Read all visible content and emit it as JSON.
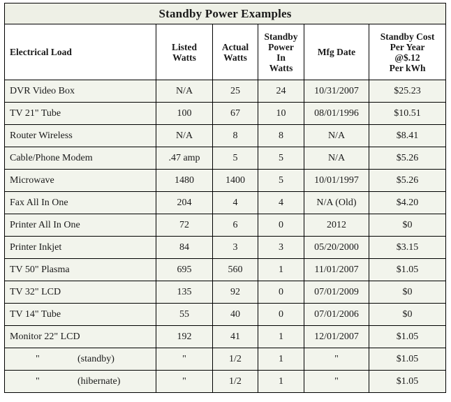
{
  "table": {
    "title": "Standby Power Examples",
    "columns": [
      {
        "key": "load",
        "label": "Electrical Load"
      },
      {
        "key": "listed",
        "label": "Listed\nWatts",
        "label_lines": [
          "Listed",
          "Watts"
        ]
      },
      {
        "key": "actual",
        "label": "Actual\nWatts",
        "label_lines": [
          "Actual",
          "Watts"
        ]
      },
      {
        "key": "standby",
        "label": "Standby Power In Watts",
        "label_lines": [
          "Standby",
          "Power",
          "In",
          "Watts"
        ]
      },
      {
        "key": "mfg",
        "label": "Mfg Date",
        "label_lines": [
          "Mfg Date"
        ]
      },
      {
        "key": "cost",
        "label": "Standby Cost Per Year @$.12 Per kWh",
        "label_lines": [
          "Standby Cost",
          "Per Year",
          "@$.12",
          "Per kWh"
        ]
      }
    ],
    "header_labels": {
      "load": "Electrical Load",
      "listed_1": "Listed",
      "listed_2": "Watts",
      "actual_1": "Actual",
      "actual_2": "Watts",
      "standby_1": "Standby",
      "standby_2": "Power",
      "standby_3": "In",
      "standby_4": "Watts",
      "mfg_1": "Mfg Date",
      "cost_1": "Standby Cost",
      "cost_2": "Per Year",
      "cost_3": "@$.12",
      "cost_4": "Per kWh"
    },
    "rows": [
      {
        "load": "DVR Video Box",
        "listed": "N/A",
        "actual": "25",
        "standby": "24",
        "mfg": "10/31/2007",
        "cost": "$25.23"
      },
      {
        "load": "TV 21\" Tube",
        "listed": "100",
        "actual": "67",
        "standby": "10",
        "mfg": "08/01/1996",
        "cost": "$10.51"
      },
      {
        "load": "Router Wireless",
        "listed": "N/A",
        "actual": "8",
        "standby": "8",
        "mfg": "N/A",
        "cost": "$8.41"
      },
      {
        "load": "Cable/Phone Modem",
        "listed": ".47 amp",
        "actual": "5",
        "standby": "5",
        "mfg": "N/A",
        "cost": "$5.26"
      },
      {
        "load": "Microwave",
        "listed": "1480",
        "actual": "1400",
        "standby": "5",
        "mfg": "10/01/1997",
        "cost": "$5.26"
      },
      {
        "load": "Fax All In One",
        "listed": "204",
        "actual": "4",
        "standby": "4",
        "mfg": "N/A (Old)",
        "cost": "$4.20"
      },
      {
        "load": "Printer All In One",
        "listed": "72",
        "actual": "6",
        "standby": "0",
        "mfg": "2012",
        "cost": "$0"
      },
      {
        "load": "Printer Inkjet",
        "listed": "84",
        "actual": "3",
        "standby": "3",
        "mfg": "05/20/2000",
        "cost": "$3.15"
      },
      {
        "load": "TV 50\" Plasma",
        "listed": "695",
        "actual": "560",
        "standby": "1",
        "mfg": "11/01/2007",
        "cost": "$1.05"
      },
      {
        "load": "TV 32\" LCD",
        "listed": "135",
        "actual": "92",
        "standby": "0",
        "mfg": "07/01/2009",
        "cost": "$0"
      },
      {
        "load": "TV 14\" Tube",
        "listed": "55",
        "actual": "40",
        "standby": "0",
        "mfg": "07/01/2006",
        "cost": "$0"
      },
      {
        "load": "Monitor 22\" LCD",
        "listed": "192",
        "actual": "41",
        "standby": "1",
        "mfg": "12/01/2007",
        "cost": "$1.05"
      },
      {
        "load_ditto": "\"",
        "load_note": "(standby)",
        "listed": "\"",
        "actual": "1/2",
        "standby": "1",
        "mfg": "\"",
        "cost": "$1.05"
      },
      {
        "load_ditto": "\"",
        "load_note": "(hibernate)",
        "listed": "\"",
        "actual": "1/2",
        "standby": "1",
        "mfg": "\"",
        "cost": "$1.05"
      }
    ]
  },
  "colors": {
    "title_background": "#eef0e6",
    "row_background": "#f2f4ec",
    "header_background": "#ffffff",
    "border": "#000000",
    "text": "#1a1a1a"
  }
}
